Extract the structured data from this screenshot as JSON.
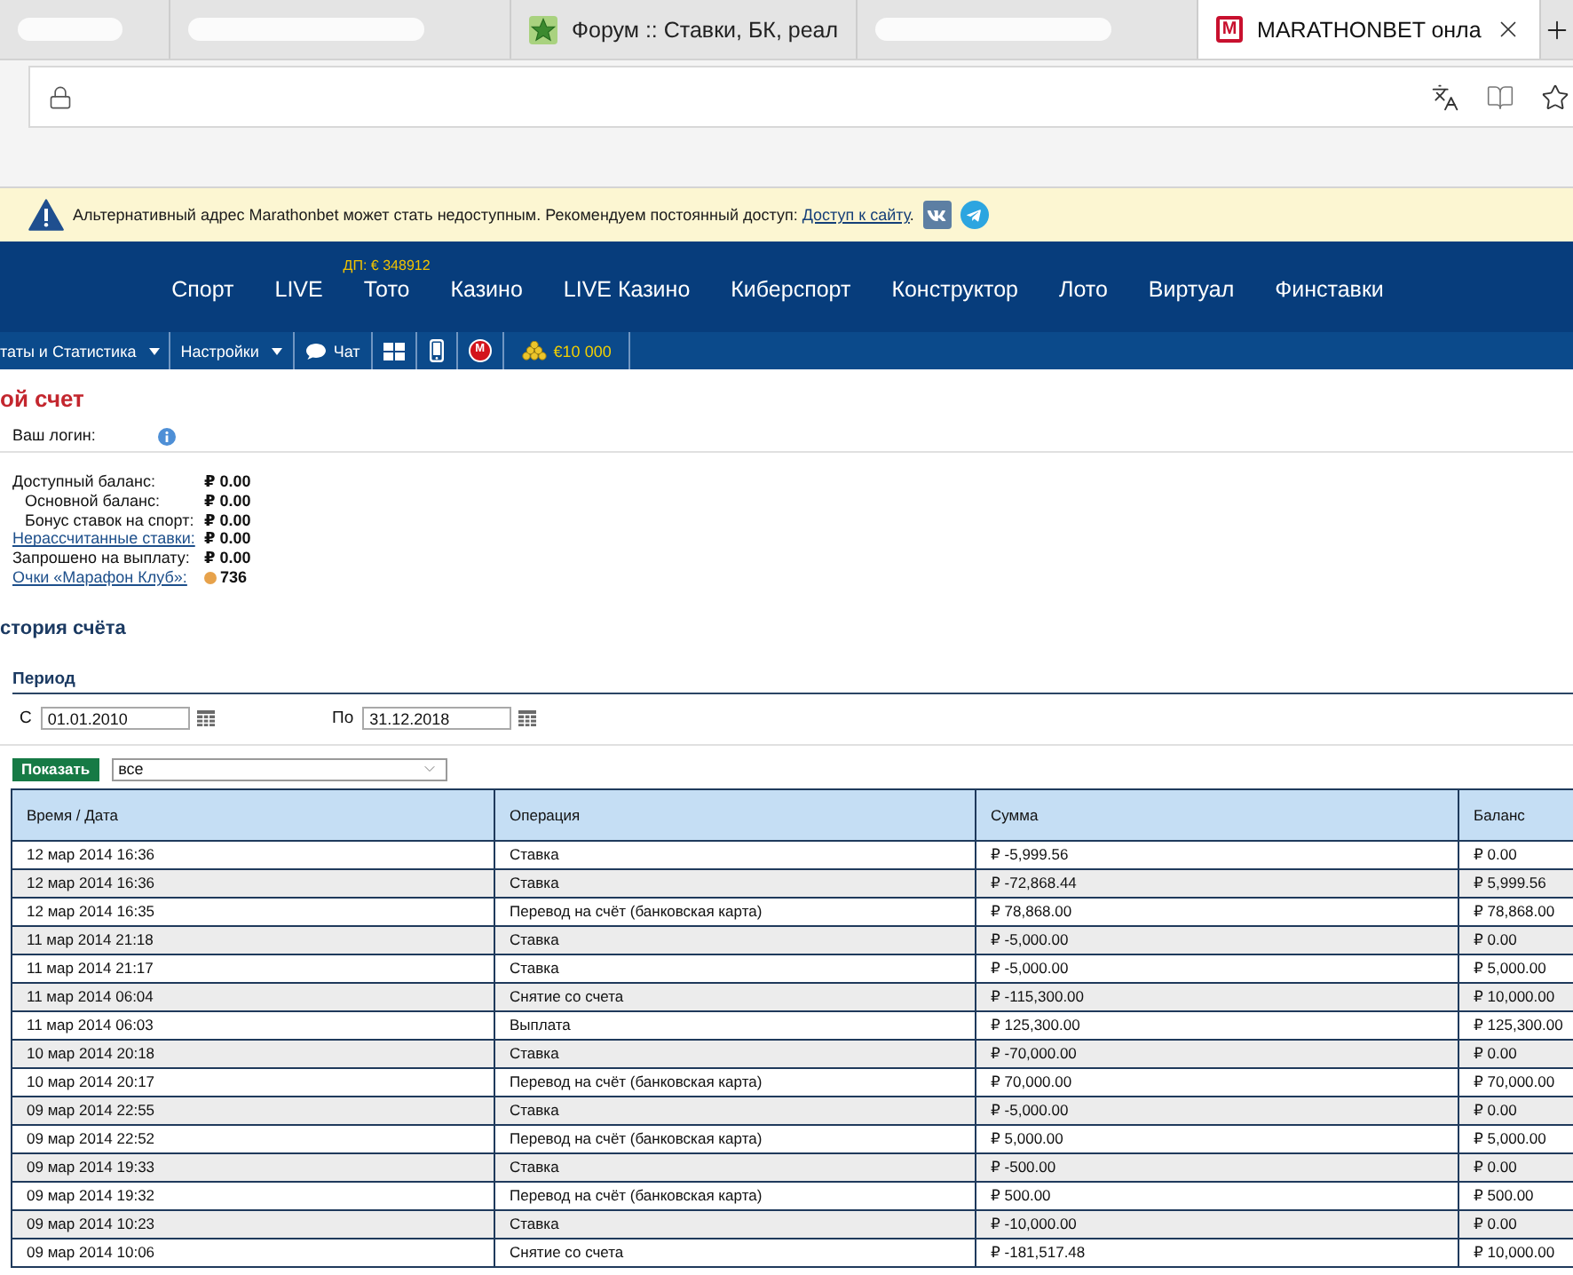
{
  "browser": {
    "tabs": [
      {
        "kind": "blurred",
        "selected": false
      },
      {
        "kind": "blurred",
        "selected": false
      },
      {
        "kind": "star",
        "title": "Форум :: Ставки, БК, реал",
        "selected": false
      },
      {
        "kind": "blurred",
        "selected": false
      },
      {
        "kind": "letter",
        "favicon_text": "M",
        "title": "MARATHONBET онла",
        "selected": true
      }
    ]
  },
  "notice": {
    "text": "Альтернативный адрес Marathonbet может стать недоступным. Рекомендуем постоянный доступ: ",
    "link": "Доступ к сайту",
    "after_link": "."
  },
  "nav": {
    "items": [
      {
        "label": "Спорт"
      },
      {
        "label": "LIVE"
      },
      {
        "label": "Тото",
        "badge": "ДП: € 348912"
      },
      {
        "label": "Казино"
      },
      {
        "label": "LIVE Казино"
      },
      {
        "label": "Киберспорт"
      },
      {
        "label": "Конструктор"
      },
      {
        "label": "Лото"
      },
      {
        "label": "Виртуал"
      },
      {
        "label": "Финставки"
      }
    ]
  },
  "toolbar": {
    "items": [
      {
        "kind": "menu",
        "label": "таты и Статистика"
      },
      {
        "kind": "menu",
        "label": "Настройки"
      },
      {
        "kind": "chat",
        "label": "Чат"
      },
      {
        "kind": "windows"
      },
      {
        "kind": "mobile"
      },
      {
        "kind": "logo",
        "label": "M"
      },
      {
        "kind": "bonus",
        "label": "€10 000"
      }
    ]
  },
  "account": {
    "title": "ой счет",
    "login_label": "Ваш логин:",
    "balances": [
      {
        "kind": "main",
        "label": "Доступный баланс:",
        "value": "₽ 0.00"
      },
      {
        "kind": "sub",
        "label": "Основной баланс:",
        "value": "₽ 0.00"
      },
      {
        "kind": "sub",
        "label": "Бонус ставок на спорт:",
        "value": "₽ 0.00"
      },
      {
        "kind": "link",
        "label": "Нерассчитанные ставки:",
        "value": "₽ 0.00"
      },
      {
        "kind": "main",
        "label": "Запрошено на выплату:",
        "value": "₽ 0.00"
      },
      {
        "kind": "points",
        "label": "Очки «Марафон Клуб»:",
        "value": "736"
      }
    ]
  },
  "history": {
    "title": "стория счёта",
    "period_title": "Период",
    "from_label": "С",
    "from_value": "01.01.2010",
    "to_label": "По",
    "to_value": "31.12.2018",
    "show_button": "Показать",
    "filter_value": "все"
  },
  "table": {
    "columns": [
      "Время / Дата",
      "Операция",
      "Сумма",
      "Баланс"
    ],
    "rows": [
      [
        "12 мар 2014 16:36",
        "Ставка",
        "₽ -5,999.56",
        "₽ 0.00"
      ],
      [
        "12 мар 2014 16:36",
        "Ставка",
        "₽ -72,868.44",
        "₽ 5,999.56"
      ],
      [
        "12 мар 2014 16:35",
        "Перевод на счёт (банковская карта)",
        "₽ 78,868.00",
        "₽ 78,868.00"
      ],
      [
        "11 мар 2014 21:18",
        "Ставка",
        "₽ -5,000.00",
        "₽ 0.00"
      ],
      [
        "11 мар 2014 21:17",
        "Ставка",
        "₽ -5,000.00",
        "₽ 5,000.00"
      ],
      [
        "11 мар 2014 06:04",
        "Снятие со счета",
        "₽ -115,300.00",
        "₽ 10,000.00"
      ],
      [
        "11 мар 2014 06:03",
        "Выплата",
        "₽ 125,300.00",
        "₽ 125,300.00"
      ],
      [
        "10 мар 2014 20:18",
        "Ставка",
        "₽ -70,000.00",
        "₽ 0.00"
      ],
      [
        "10 мар 2014 20:17",
        "Перевод на счёт (банковская карта)",
        "₽ 70,000.00",
        "₽ 70,000.00"
      ],
      [
        "09 мар 2014 22:55",
        "Ставка",
        "₽ -5,000.00",
        "₽ 0.00"
      ],
      [
        "09 мар 2014 22:52",
        "Перевод на счёт (банковская карта)",
        "₽ 5,000.00",
        "₽ 5,000.00"
      ],
      [
        "09 мар 2014 19:33",
        "Ставка",
        "₽ -500.00",
        "₽ 0.00"
      ],
      [
        "09 мар 2014 19:32",
        "Перевод на счёт (банковская карта)",
        "₽ 500.00",
        "₽ 500.00"
      ],
      [
        "09 мар 2014 10:23",
        "Ставка",
        "₽ -10,000.00",
        "₽ 0.00"
      ],
      [
        "09 мар 2014 10:06",
        "Снятие со счета",
        "₽ -181,517.48",
        "₽ 10,000.00"
      ]
    ]
  }
}
